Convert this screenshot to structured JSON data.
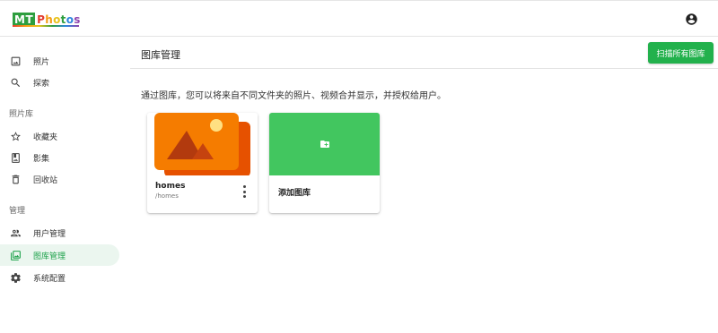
{
  "app": {
    "logo_mt": "MT",
    "logo_photos": [
      "P",
      "h",
      "o",
      "t",
      "o",
      "s"
    ]
  },
  "header": {
    "account_icon": "account-circle-icon"
  },
  "sidebar": {
    "items_top": [
      {
        "label": "照片",
        "icon": "photo-icon"
      },
      {
        "label": "探索",
        "icon": "search-icon"
      }
    ],
    "section_library": "照片库",
    "items_library": [
      {
        "label": "收藏夹",
        "icon": "star-icon"
      },
      {
        "label": "影集",
        "icon": "album-icon"
      },
      {
        "label": "回收站",
        "icon": "trash-icon"
      }
    ],
    "section_manage": "管理",
    "items_manage": [
      {
        "label": "用户管理",
        "icon": "users-icon"
      },
      {
        "label": "图库管理",
        "icon": "gallery-icon",
        "active": true
      },
      {
        "label": "系统配置",
        "icon": "gear-icon"
      }
    ]
  },
  "main": {
    "title": "图库管理",
    "scan_button": "扫描所有图库",
    "description": "通过图库，您可以将来自不同文件夹的照片、视频合并显示，并授权给用户。",
    "galleries": [
      {
        "name": "homes",
        "path": "/homes"
      }
    ],
    "add_gallery_label": "添加图库"
  },
  "colors": {
    "accent": "#22b14c",
    "active_bg": "#ebf6ef",
    "add_card": "#42c65f",
    "thumb_orange": "#f57c00"
  }
}
